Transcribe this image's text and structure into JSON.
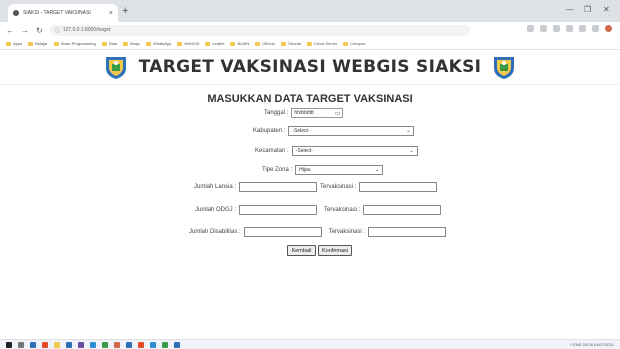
{
  "browser": {
    "tab_title": "SIAKSI - TARGET VAKSINASI",
    "new_tab_symbol": "+",
    "url": "127.0.0.1:8000/target",
    "bookmarks": [
      "Apps",
      "Belajar",
      "Kisah Programming",
      "Data",
      "Maps",
      "WhatsApp",
      "WebGIS",
      "Leaflet",
      "BUMN",
      "GitHub",
      "Tutorial",
      "Cloud Server",
      "Campus"
    ]
  },
  "header": {
    "title": "TARGET VAKSINASI WEBGIS SIAKSI"
  },
  "form": {
    "title": "MASUKKAN DATA TARGET VAKSINASI",
    "tanggal_label": "Tanggal :",
    "tanggal_placeholder": "hh/bb/tttt",
    "kabupaten_label": "Kabupaten :",
    "kabupaten_value": "-Select-",
    "kecamatan_label": "Kecamatan :",
    "kecamatan_value": "-Select-",
    "tipe_zona_label": "Tipe Zona :",
    "tipe_zona_value": "Hijau",
    "lansia_label": "Jumlah Lansia :",
    "tervaksinasi_label": "Tervaksinasi :",
    "odgj_label": "Jumlah ODGJ :",
    "disabilitas_label": "Jumlah Disabilitas :",
    "batal_label": "Kembali",
    "konfirmasi_label": "Konfirmasi"
  },
  "taskbar": {
    "tray_text": "^ ENG 09:28 01/07/2021"
  },
  "colors": {
    "logo_blue": "#2f6fb7",
    "logo_yellow": "#f2c94c",
    "logo_green": "#3a9a45"
  }
}
